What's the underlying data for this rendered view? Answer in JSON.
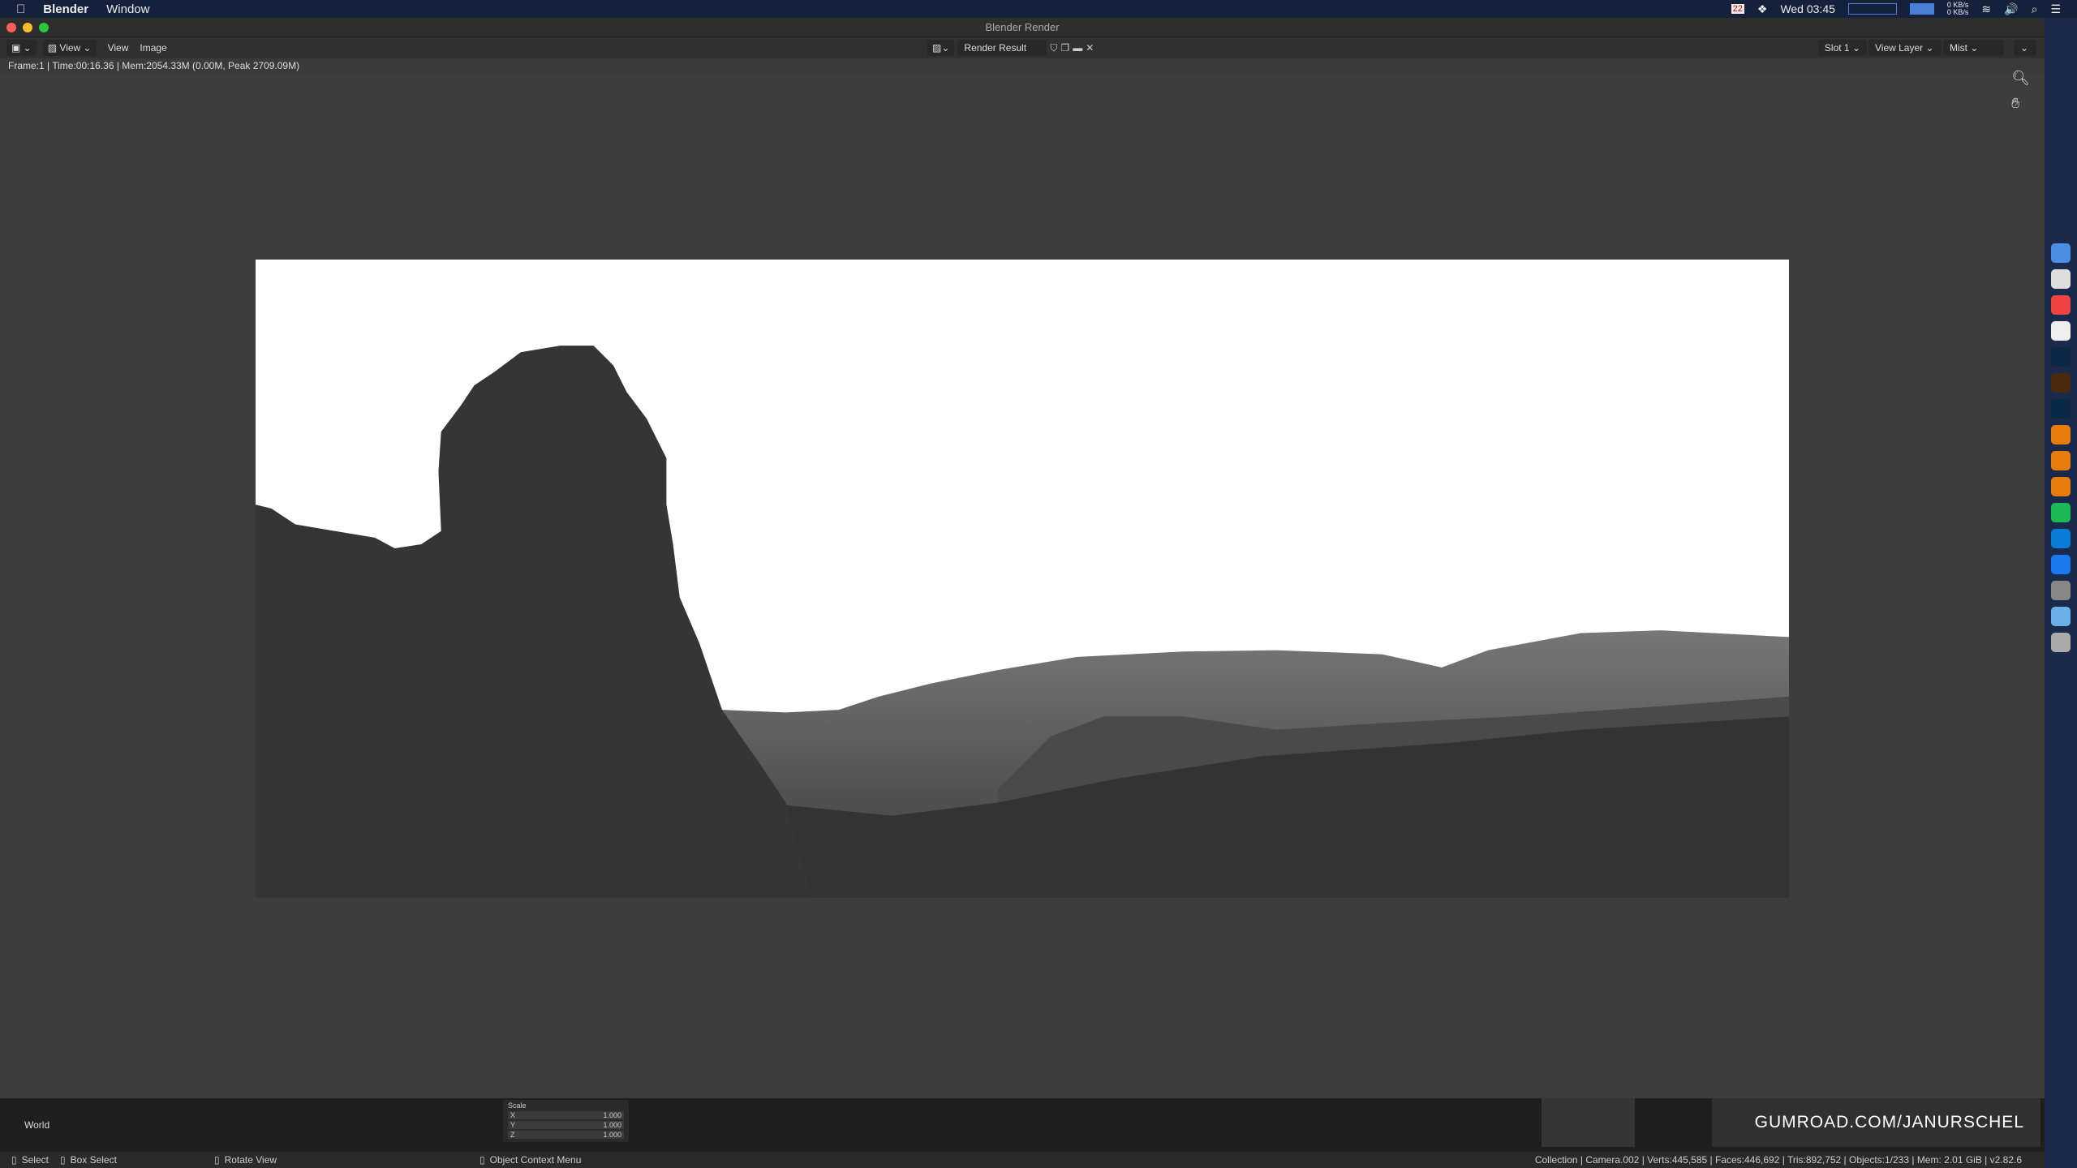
{
  "menubar": {
    "app": "Blender",
    "menu": "Window",
    "clock": "Wed 03:45",
    "calendar_day": "22",
    "net_up": "0 KB/s",
    "net_down": "0 KB/s"
  },
  "window": {
    "title": "Blender Render"
  },
  "header": {
    "view_menu": "View",
    "menu_view": "View",
    "menu_image": "Image",
    "image_name": "Render Result",
    "slot": "Slot 1",
    "view_layer": "View Layer",
    "pass": "Mist"
  },
  "info": "Frame:1 | Time:00:16.36 | Mem:2054.33M (0.00M, Peak 2709.09M)",
  "bottom": {
    "world": "World",
    "scale_label": "Scale",
    "scale": [
      {
        "axis": "X",
        "value": "1.000"
      },
      {
        "axis": "Y",
        "value": "1.000"
      },
      {
        "axis": "Z",
        "value": "1.000"
      }
    ],
    "gumroad": "GUMROAD.COM/JANURSCHEL"
  },
  "status": {
    "select": "Select",
    "box_select": "Box Select",
    "rotate_view": "Rotate View",
    "context_menu": "Object Context Menu",
    "stats": "Collection | Camera.002 | Verts:445,585 | Faces:446,692 | Tris:892,752 | Objects:1/233 | Mem: 2.01 GiB | v2.82.6"
  },
  "colors": {
    "accent": "#4a7fd6",
    "editor_bg": "#3d3d3d"
  }
}
